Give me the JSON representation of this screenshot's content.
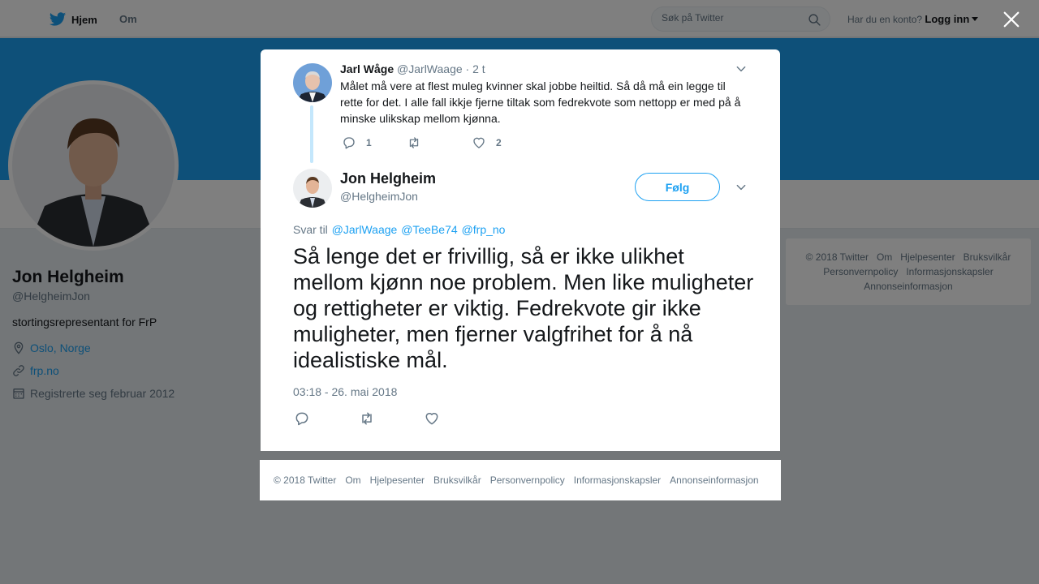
{
  "topbar": {
    "home_label": "Hjem",
    "about_label": "Om",
    "search_placeholder": "Søk på Twitter",
    "account_question": "Har du en konto?",
    "login_label": "Logg inn"
  },
  "profile": {
    "name": "Jon Helgheim",
    "handle": "@HelgheimJon",
    "bio": "stortingsrepresentant for FrP",
    "location": "Oslo, Norge",
    "website": "frp.no",
    "joined": "Registrerte seg februar 2012"
  },
  "side_footer": {
    "copyright": "© 2018 Twitter",
    "links": [
      "Om",
      "Hjelpesenter",
      "Bruksvilkår",
      "Personvernpolicy",
      "Informasjonskapsler",
      "Annonseinformasjon"
    ]
  },
  "parent_tweet": {
    "name": "Jarl Wåge",
    "handle": "@JarlWaage",
    "time": "· 2 t",
    "text": "Målet må vere at flest muleg kvinner skal jobbe heiltid. Så då må ein legge til rette for det. I alle fall ikkje fjerne tiltak som fedrekvote som nettopp er med på å minske ulikskap mellom kjønna.",
    "reply_count": "1",
    "like_count": "2"
  },
  "main_tweet": {
    "name": "Jon Helgheim",
    "handle": "@HelgheimJon",
    "follow_label": "Følg",
    "reply_prefix": "Svar til",
    "reply_mentions": [
      "@JarlWaage",
      "@TeeBe74",
      "@frp_no"
    ],
    "text": "Så lenge det er frivillig, så er ikke ulikhet mellom kjønn noe problem. Men like muligheter og rettigheter er viktig. Fedrekvote gir ikke muligheter, men fjerner valgfrihet for å nå idealistiske mål.",
    "timestamp": "03:18 - 26. mai 2018"
  },
  "modal_footer": {
    "copyright": "© 2018 Twitter",
    "links": [
      "Om",
      "Hjelpesenter",
      "Bruksvilkår",
      "Personvernpolicy",
      "Informasjonskapsler",
      "Annonseinformasjon"
    ]
  },
  "icons": {
    "logo": "twitter-bird-icon",
    "search": "search-icon",
    "close": "close-icon",
    "location": "location-pin-icon",
    "link": "link-icon",
    "calendar": "calendar-icon",
    "reply": "reply-icon",
    "retweet": "retweet-icon",
    "like": "heart-icon",
    "more": "chevron-down-icon"
  },
  "colors": {
    "accent": "#1da1f2",
    "banner": "#1da1f2",
    "thread_line": "#c4e7fc",
    "text": "#14171a",
    "muted": "#657786"
  }
}
